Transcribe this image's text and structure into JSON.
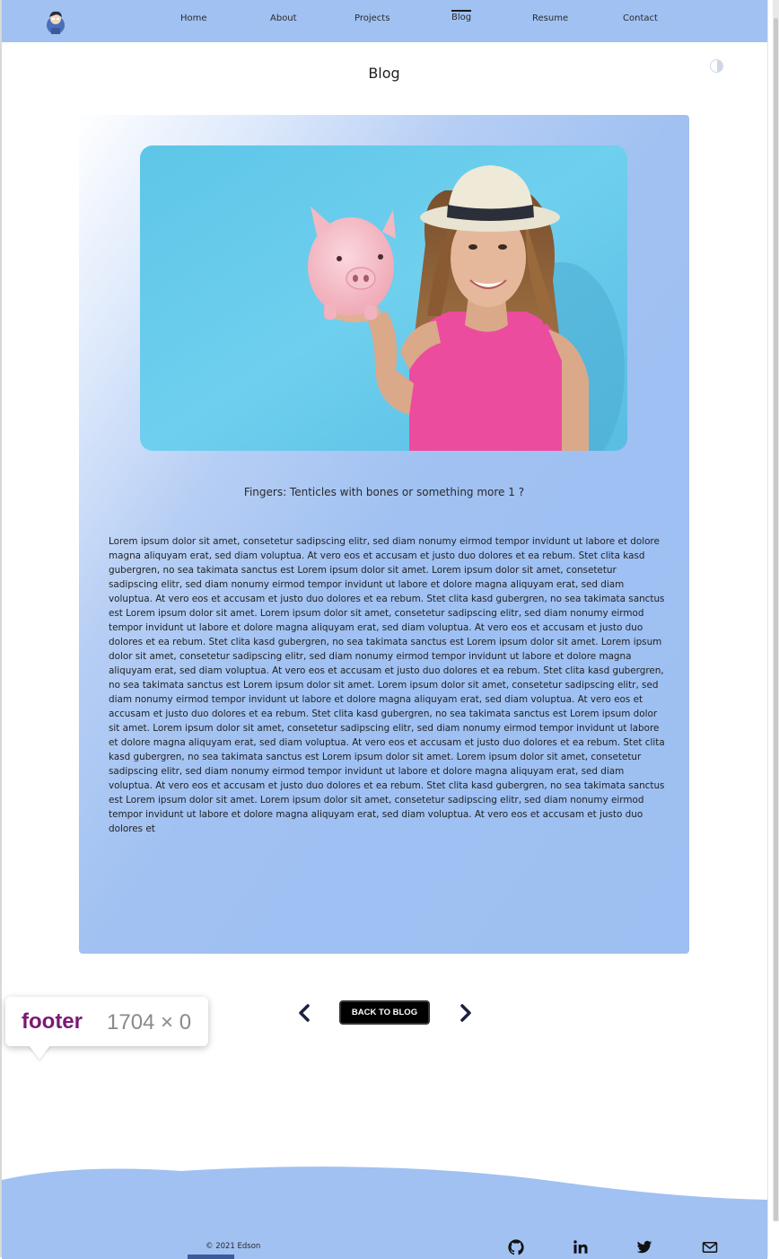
{
  "nav": {
    "items": [
      {
        "label": "Home"
      },
      {
        "label": "About"
      },
      {
        "label": "Projects"
      },
      {
        "label": "Blog",
        "active": true
      },
      {
        "label": "Resume"
      },
      {
        "label": "Contact"
      }
    ],
    "avatar_icon": "avatar-icon"
  },
  "theme_toggle_icon": "half-circle-contrast-icon",
  "page": {
    "title": "Blog"
  },
  "post": {
    "title": "Fingers: Tenticles with bones or something more 1 ?",
    "image_description_icon": "hero-photo",
    "body": "Lorem ipsum dolor sit amet, consetetur sadipscing elitr, sed diam nonumy eirmod tempor invidunt ut labore et dolore magna aliquyam erat, sed diam voluptua. At vero eos et accusam et justo duo dolores et ea rebum. Stet clita kasd gubergren, no sea takimata sanctus est Lorem ipsum dolor sit amet. Lorem ipsum dolor sit amet, consetetur sadipscing elitr, sed diam nonumy eirmod tempor invidunt ut labore et dolore magna aliquyam erat, sed diam voluptua. At vero eos et accusam et justo duo dolores et ea rebum. Stet clita kasd gubergren, no sea takimata sanctus est Lorem ipsum dolor sit amet. Lorem ipsum dolor sit amet, consetetur sadipscing elitr, sed diam nonumy eirmod tempor invidunt ut labore et dolore magna aliquyam erat, sed diam voluptua. At vero eos et accusam et justo duo dolores et ea rebum. Stet clita kasd gubergren, no sea takimata sanctus est Lorem ipsum dolor sit amet. Lorem ipsum dolor sit amet, consetetur sadipscing elitr, sed diam nonumy eirmod tempor invidunt ut labore et dolore magna aliquyam erat, sed diam voluptua. At vero eos et accusam et justo duo dolores et ea rebum. Stet clita kasd gubergren, no sea takimata sanctus est Lorem ipsum dolor sit amet. Lorem ipsum dolor sit amet, consetetur sadipscing elitr, sed diam nonumy eirmod tempor invidunt ut labore et dolore magna aliquyam erat, sed diam voluptua. At vero eos et accusam et justo duo dolores et ea rebum. Stet clita kasd gubergren, no sea takimata sanctus est Lorem ipsum dolor sit amet. Lorem ipsum dolor sit amet, consetetur sadipscing elitr, sed diam nonumy eirmod tempor invidunt ut labore et dolore magna aliquyam erat, sed diam voluptua. At vero eos et accusam et justo duo dolores et ea rebum. Stet clita kasd gubergren, no sea takimata sanctus est Lorem ipsum dolor sit amet. Lorem ipsum dolor sit amet, consetetur sadipscing elitr, sed diam nonumy eirmod tempor invidunt ut labore et dolore magna aliquyam erat, sed diam voluptua. At vero eos et accusam et justo duo dolores et ea rebum. Stet clita kasd gubergren, no sea takimata sanctus est Lorem ipsum dolor sit amet. Lorem ipsum dolor sit amet, consetetur sadipscing elitr, sed diam nonumy eirmod tempor invidunt ut labore et dolore magna aliquyam erat, sed diam voluptua. At vero eos et accusam et justo duo dolores et"
  },
  "pager": {
    "back_label": "BACK TO BLOG",
    "prev_icon": "chevron-left-icon",
    "next_icon": "chevron-right-icon"
  },
  "devtools_tooltip": {
    "tag": "footer",
    "dims": "1704 × 0"
  },
  "footer": {
    "copyright": "© 2021 Edson",
    "social": [
      {
        "icon": "github-icon"
      },
      {
        "icon": "linkedin-icon"
      },
      {
        "icon": "twitter-icon"
      },
      {
        "icon": "mail-icon"
      }
    ]
  },
  "colors": {
    "accent": "#a0c1f2",
    "button": "#000000",
    "tooltip_tag": "#7a1a74"
  }
}
